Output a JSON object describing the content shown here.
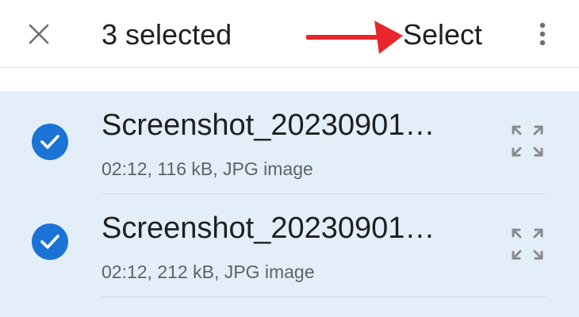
{
  "header": {
    "title": "3 selected",
    "select_label": "Select",
    "close_icon": "close-icon",
    "more_icon": "more-vert-icon",
    "annotation_arrow_color": "#e8262b"
  },
  "files": [
    {
      "name": "Screenshot_20230901…",
      "meta": "02:12, 116 kB, JPG image",
      "selected": true
    },
    {
      "name": "Screenshot_20230901…",
      "meta": "02:12, 212 kB, JPG image",
      "selected": true
    }
  ],
  "colors": {
    "selected_bg": "#e3eef9",
    "check_blue": "#1c73d6",
    "icon_gray": "#8a8a8a"
  }
}
